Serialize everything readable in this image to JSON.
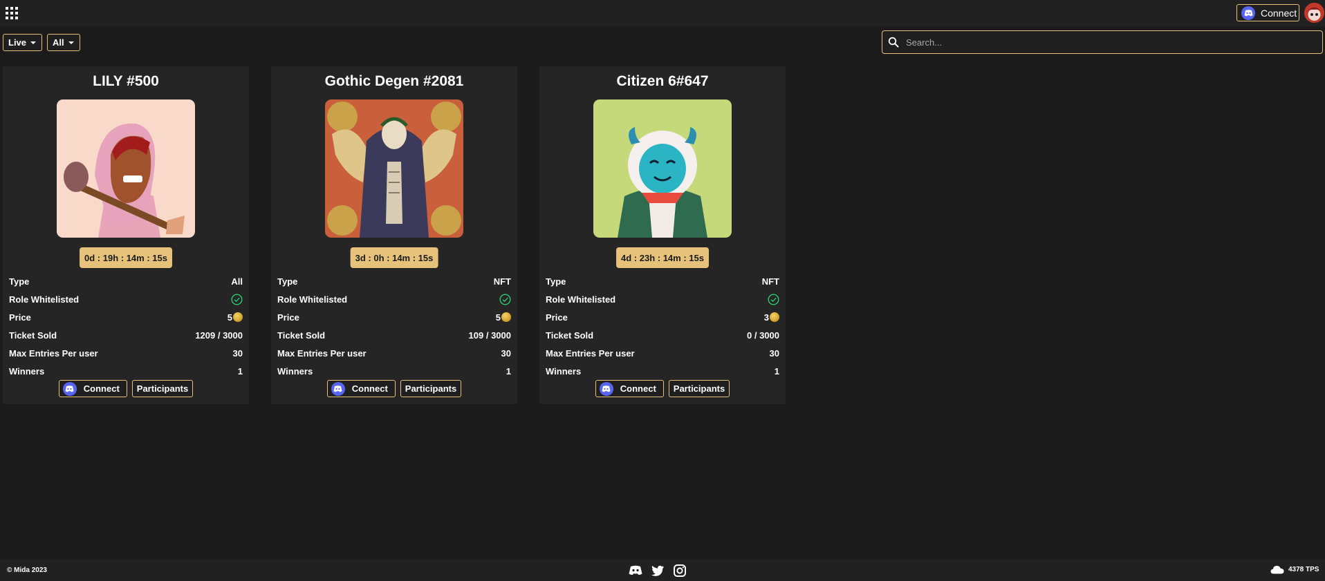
{
  "header": {
    "connect_label": "Connect"
  },
  "filters": {
    "status_label": "Live",
    "type_label": "All"
  },
  "search": {
    "placeholder": "Search..."
  },
  "field_labels": {
    "type": "Type",
    "role_whitelisted": "Role Whitelisted",
    "price": "Price",
    "ticket_sold": "Ticket Sold",
    "max_entries": "Max Entries Per user",
    "winners": "Winners"
  },
  "cards": [
    {
      "title": "LILY #500",
      "timer": "0d : 19h : 14m : 15s",
      "type": "All",
      "price": "5",
      "ticket_sold": "1209 / 3000",
      "max_entries": "30",
      "winners": "1",
      "connect_label": "Connect",
      "participants_label": "Participants"
    },
    {
      "title": "Gothic Degen #2081",
      "timer": "3d : 0h : 14m : 15s",
      "type": "NFT",
      "price": "5",
      "ticket_sold": "109 / 3000",
      "max_entries": "30",
      "winners": "1",
      "connect_label": "Connect",
      "participants_label": "Participants"
    },
    {
      "title": "Citizen 6#647",
      "timer": "4d : 23h : 14m : 15s",
      "type": "NFT",
      "price": "3",
      "ticket_sold": "0 / 3000",
      "max_entries": "30",
      "winners": "1",
      "connect_label": "Connect",
      "participants_label": "Participants"
    }
  ],
  "footer": {
    "copyright": "© Mida 2023",
    "tps": "4378 TPS"
  },
  "colors": {
    "accent": "#e6c27a",
    "background": "#1b1b1b",
    "card": "#252525",
    "discord": "#5865f2",
    "check": "#2ecc71"
  },
  "icons": [
    "apps-grid-icon",
    "discord-icon",
    "avatar",
    "search-icon",
    "check-circle-icon",
    "coin-icon",
    "twitter-icon",
    "instagram-icon",
    "cloud-icon"
  ]
}
